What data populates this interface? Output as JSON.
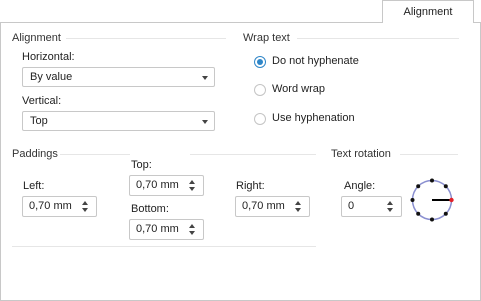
{
  "tab": {
    "label": "Alignment"
  },
  "alignment": {
    "title": "Alignment",
    "horizontal_label": "Horizontal:",
    "horizontal_value": "By value",
    "vertical_label": "Vertical:",
    "vertical_value": "Top"
  },
  "wrap": {
    "title": "Wrap text",
    "options": [
      {
        "label": "Do not hyphenate",
        "checked": true
      },
      {
        "label": "Word wrap",
        "checked": false
      },
      {
        "label": "Use hyphenation",
        "checked": false
      }
    ]
  },
  "paddings": {
    "title": "Paddings",
    "left_label": "Left:",
    "left_value": "0,70 mm",
    "top_label": "Top:",
    "top_value": "0,70 mm",
    "bottom_label": "Bottom:",
    "bottom_value": "0,70 mm",
    "right_label": "Right:",
    "right_value": "0,70 mm"
  },
  "rotation": {
    "title": "Text rotation",
    "angle_label": "Angle:",
    "angle_value": "0",
    "dial_icon": "rotation-dial-icon",
    "accent_color": "#e0202a"
  },
  "colors": {
    "radio_accent": "#2f86c8"
  }
}
